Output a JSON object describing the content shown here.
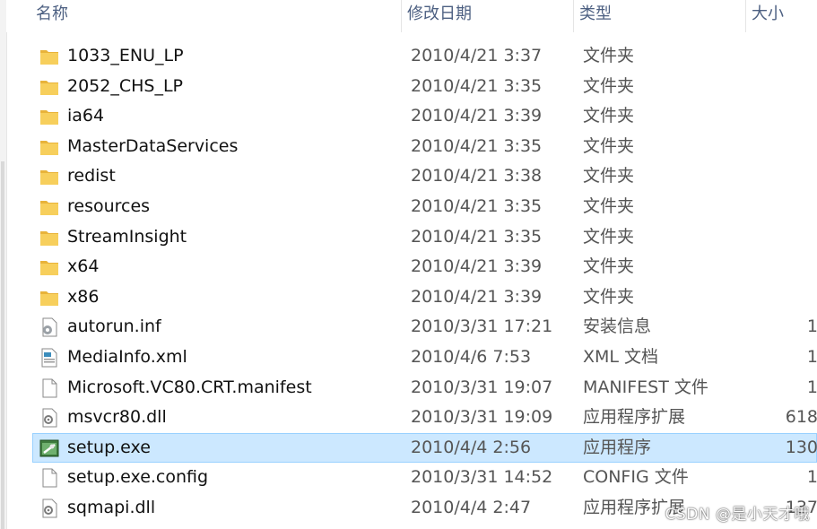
{
  "columns": {
    "name": "名称",
    "date": "修改日期",
    "type": "类型",
    "size": "大小"
  },
  "files": [
    {
      "name": "1033_ENU_LP",
      "date": "2010/4/21 3:37",
      "type": "文件夹",
      "size": "",
      "icon": "folder-icon"
    },
    {
      "name": "2052_CHS_LP",
      "date": "2010/4/21 3:35",
      "type": "文件夹",
      "size": "",
      "icon": "folder-icon"
    },
    {
      "name": "ia64",
      "date": "2010/4/21 3:39",
      "type": "文件夹",
      "size": "",
      "icon": "folder-icon"
    },
    {
      "name": "MasterDataServices",
      "date": "2010/4/21 3:35",
      "type": "文件夹",
      "size": "",
      "icon": "folder-icon"
    },
    {
      "name": "redist",
      "date": "2010/4/21 3:38",
      "type": "文件夹",
      "size": "",
      "icon": "folder-icon"
    },
    {
      "name": "resources",
      "date": "2010/4/21 3:35",
      "type": "文件夹",
      "size": "",
      "icon": "folder-icon"
    },
    {
      "name": "StreamInsight",
      "date": "2010/4/21 3:35",
      "type": "文件夹",
      "size": "",
      "icon": "folder-icon"
    },
    {
      "name": "x64",
      "date": "2010/4/21 3:39",
      "type": "文件夹",
      "size": "",
      "icon": "folder-icon"
    },
    {
      "name": "x86",
      "date": "2010/4/21 3:39",
      "type": "文件夹",
      "size": "",
      "icon": "folder-icon"
    },
    {
      "name": "autorun.inf",
      "date": "2010/3/31 17:21",
      "type": "安装信息",
      "size": "1",
      "icon": "settings-file-icon"
    },
    {
      "name": "MediaInfo.xml",
      "date": "2010/4/6 7:53",
      "type": "XML 文档",
      "size": "1",
      "icon": "xml-file-icon"
    },
    {
      "name": "Microsoft.VC80.CRT.manifest",
      "date": "2010/3/31 19:07",
      "type": "MANIFEST 文件",
      "size": "1",
      "icon": "blank-file-icon"
    },
    {
      "name": "msvcr80.dll",
      "date": "2010/3/31 19:09",
      "type": "应用程序扩展",
      "size": "618",
      "icon": "dll-file-icon"
    },
    {
      "name": "setup.exe",
      "date": "2010/4/4 2:56",
      "type": "应用程序",
      "size": "130",
      "icon": "setup-exe-icon",
      "selected": true
    },
    {
      "name": "setup.exe.config",
      "date": "2010/3/31 14:52",
      "type": "CONFIG 文件",
      "size": "1",
      "icon": "blank-file-icon"
    },
    {
      "name": "sqmapi.dll",
      "date": "2010/4/4 2:47",
      "type": "应用程序扩展",
      "size": "137",
      "icon": "dll-file-icon"
    }
  ],
  "watermark": "CSDN @是小天才哦",
  "colors": {
    "selection_bg": "#cce8ff",
    "selection_border": "#99d1ff",
    "folder": "#f4c44e",
    "header_text": "#4d6082"
  }
}
